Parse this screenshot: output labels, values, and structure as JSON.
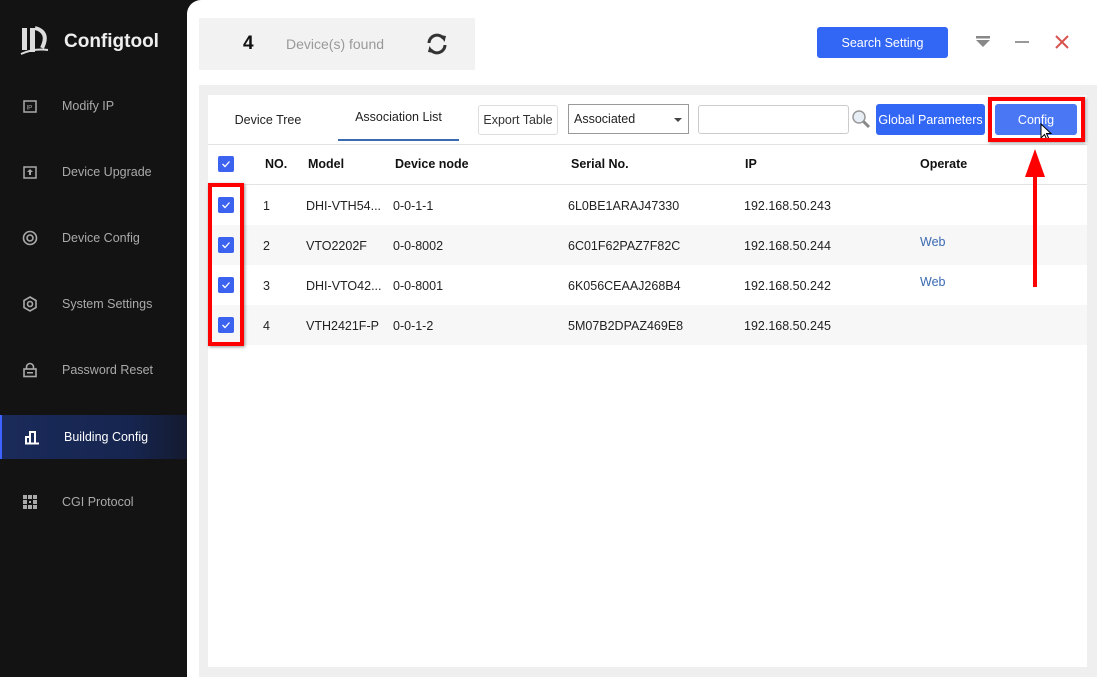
{
  "app": {
    "name": "Configtool"
  },
  "sidebar": {
    "items": [
      {
        "label": "Modify IP",
        "icon": "ip-icon"
      },
      {
        "label": "Device Upgrade",
        "icon": "upload-icon"
      },
      {
        "label": "Device Config",
        "icon": "target-icon"
      },
      {
        "label": "System Settings",
        "icon": "hexagon-gear-icon"
      },
      {
        "label": "Password Reset",
        "icon": "lock-icon"
      },
      {
        "label": "Building Config",
        "icon": "building-icon",
        "active": true
      },
      {
        "label": "CGI Protocol",
        "icon": "grid-icon"
      }
    ]
  },
  "header": {
    "count": "4",
    "count_label": "Device(s) found",
    "search_setting": "Search Setting"
  },
  "toolbar": {
    "tabs": [
      "Device Tree",
      "Association List"
    ],
    "active_tab": "Association List",
    "export": "Export Table",
    "filter": "Associated",
    "search_value": "",
    "global_params": "Global Parameters",
    "config": "Config"
  },
  "table": {
    "headers": [
      "NO.",
      "Model",
      "Device node",
      "Serial No.",
      "IP",
      "Operate"
    ],
    "rows": [
      {
        "no": "1",
        "model": "DHI-VTH54...",
        "node": "0-0-1-1",
        "serial": "6L0BE1ARAJ47330",
        "ip": "192.168.50.243",
        "operate": "",
        "checked": true
      },
      {
        "no": "2",
        "model": "VTO2202F",
        "node": "0-0-8002",
        "serial": "6C01F62PAZ7F82C",
        "ip": "192.168.50.244",
        "operate": "Web",
        "checked": true
      },
      {
        "no": "3",
        "model": "DHI-VTO42...",
        "node": "0-0-8001",
        "serial": "6K056CEAAJ268B4",
        "ip": "192.168.50.242",
        "operate": "Web",
        "checked": true
      },
      {
        "no": "4",
        "model": "VTH2421F-P",
        "node": "0-0-1-2",
        "serial": "5M07B2DPAZ469E8",
        "ip": "192.168.50.245",
        "operate": "",
        "checked": true
      }
    ]
  },
  "colors": {
    "accent": "#3267f5",
    "annotation": "#ff0000",
    "sidebar": "#131313"
  }
}
